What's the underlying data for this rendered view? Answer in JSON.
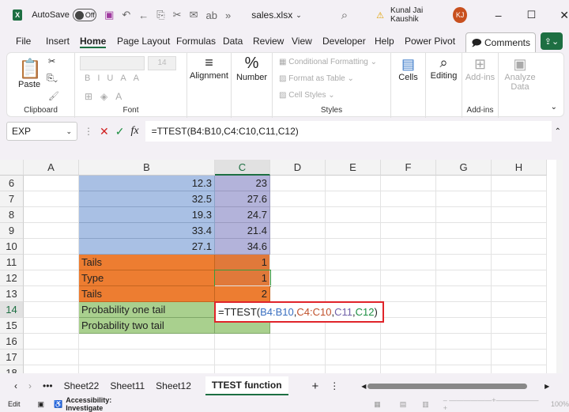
{
  "titlebar": {
    "autosave_label": "AutoSave",
    "autosave_state": "Off",
    "filename": "sales.xlsx",
    "user": "Kunal Jai Kaushik",
    "initials": "KJ"
  },
  "tabs": [
    "File",
    "Insert",
    "Home",
    "Page Layout",
    "Formulas",
    "Data",
    "Review",
    "View",
    "Developer",
    "Help",
    "Power Pivot"
  ],
  "active_tab": "Home",
  "comments_label": "Comments",
  "ribbon": {
    "paste": "Paste",
    "clipboard": "Clipboard",
    "font_size": "14",
    "font": "Font",
    "alignment": "Alignment",
    "number": "Number",
    "conditional_formatting": "Conditional Formatting",
    "format_as_table": "Format as Table",
    "cell_styles": "Cell Styles",
    "styles": "Styles",
    "cells": "Cells",
    "editing": "Editing",
    "addins": "Add-ins",
    "addins_group": "Add-ins",
    "analyze_data": "Analyze Data"
  },
  "formula_bar": {
    "name_box": "EXP",
    "fx": "fx",
    "formula": "=TTEST(B4:B10,C4:C10,C11,C12)"
  },
  "columns": [
    "A",
    "B",
    "C",
    "D",
    "E",
    "F",
    "G",
    "H"
  ],
  "rows": [
    {
      "n": "6",
      "b": "12.3",
      "c": "23"
    },
    {
      "n": "7",
      "b": "32.5",
      "c": "27.6"
    },
    {
      "n": "8",
      "b": "19.3",
      "c": "24.7"
    },
    {
      "n": "9",
      "b": "33.4",
      "c": "21.4"
    },
    {
      "n": "10",
      "b": "27.1",
      "c": "34.6"
    },
    {
      "n": "11",
      "b": "Tails",
      "c": "1"
    },
    {
      "n": "12",
      "b": "Type",
      "c": "1"
    },
    {
      "n": "13",
      "b": "Tails",
      "c": "2"
    },
    {
      "n": "14",
      "b": "Probability one tail",
      "c": ""
    },
    {
      "n": "15",
      "b": "Probability two tail",
      "c": ""
    },
    {
      "n": "16",
      "b": "",
      "c": ""
    },
    {
      "n": "17",
      "b": "",
      "c": ""
    },
    {
      "n": "18",
      "b": "",
      "c": ""
    }
  ],
  "edit_formula": {
    "prefix": "=TTEST(",
    "a1": "B4:B10",
    "a2": "C4:C10",
    "a3": "C11",
    "a4": "C12",
    "sep": ",",
    "suffix": ")"
  },
  "sheets": [
    "Sheet22",
    "Sheet11",
    "Sheet12",
    "TTEST function"
  ],
  "active_sheet": "TTEST function",
  "status": {
    "mode": "Edit",
    "accessibility": "Accessibility: Investigate",
    "zoom": "100%"
  },
  "colors": {
    "accent": "#1d6f42",
    "range_blue": "#a9c0e4",
    "range_purple": "#b3b3da",
    "orange": "#ed7d31",
    "green": "#a9d08e",
    "highlight_box": "#e0242a"
  }
}
